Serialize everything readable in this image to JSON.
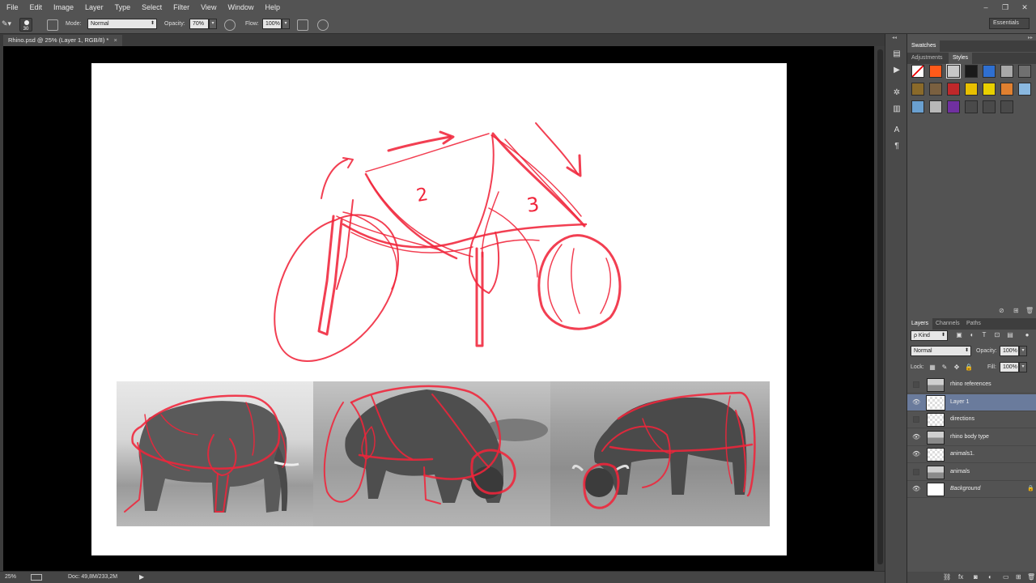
{
  "menu": [
    "File",
    "Edit",
    "Image",
    "Layer",
    "Type",
    "Select",
    "Filter",
    "View",
    "Window",
    "Help"
  ],
  "window_controls": [
    "–",
    "❐",
    "✕"
  ],
  "options": {
    "brush_size": "30",
    "mode_label": "Mode:",
    "mode_value": "Normal",
    "opacity_label": "Opacity:",
    "opacity_value": "70%",
    "flow_label": "Flow:",
    "flow_value": "100%",
    "workspace": "Essentials"
  },
  "document_tab": {
    "title": "Rhino.psd @ 25% (Layer 1, RGB/8) *",
    "close": "×"
  },
  "sketch": {
    "label_2": "2",
    "label_3": "3"
  },
  "status": {
    "zoom": "25%",
    "doc": "Doc: 49,8M/233,2M"
  },
  "panels_top": {
    "tab_swatches": "Swatches",
    "tab_adjustments": "Adjustments",
    "tab_styles": "Styles",
    "style_swatches": [
      [
        "#ffffff",
        "#ff5a1a",
        "#c8c8c8",
        "#1a1a1a",
        "#2f6fd0",
        "#a8a8a8",
        "#707070"
      ],
      [
        "#8a6a2a",
        "#7a6040",
        "#c0282a",
        "#e8c000",
        "#e8d000",
        "#e08030",
        "#8ab8e0"
      ],
      [
        "#6aa0d0",
        "#b8b8b8",
        "#7030a0",
        "#4a4a4a",
        "#4a4a4a",
        "#4a4a4a",
        ""
      ]
    ]
  },
  "layers_panel": {
    "tab_layers": "Layers",
    "tab_channels": "Channels",
    "tab_paths": "Paths",
    "filter_kind": "ρ Kind",
    "blend_mode": "Normal",
    "opacity_label": "Opacity:",
    "opacity_value": "100%",
    "lock_label": "Lock:",
    "fill_label": "Fill:",
    "fill_value": "100%",
    "layers": [
      {
        "name": "rhino references",
        "visible": false,
        "thumb": "photo",
        "selected": false
      },
      {
        "name": "Layer 1",
        "visible": true,
        "thumb": "check",
        "selected": true
      },
      {
        "name": "directions",
        "visible": false,
        "thumb": "check",
        "selected": false
      },
      {
        "name": "rhino body type",
        "visible": true,
        "thumb": "photo",
        "selected": false
      },
      {
        "name": "animals1.",
        "visible": true,
        "thumb": "check",
        "selected": false
      },
      {
        "name": "animals",
        "visible": false,
        "thumb": "photo",
        "selected": false
      },
      {
        "name": "Background",
        "visible": true,
        "thumb": "white",
        "selected": false
      }
    ]
  },
  "colors": {
    "sketch_red": "#f0243a",
    "chrome": "#535353",
    "selected_layer": "#6a7b9c"
  }
}
